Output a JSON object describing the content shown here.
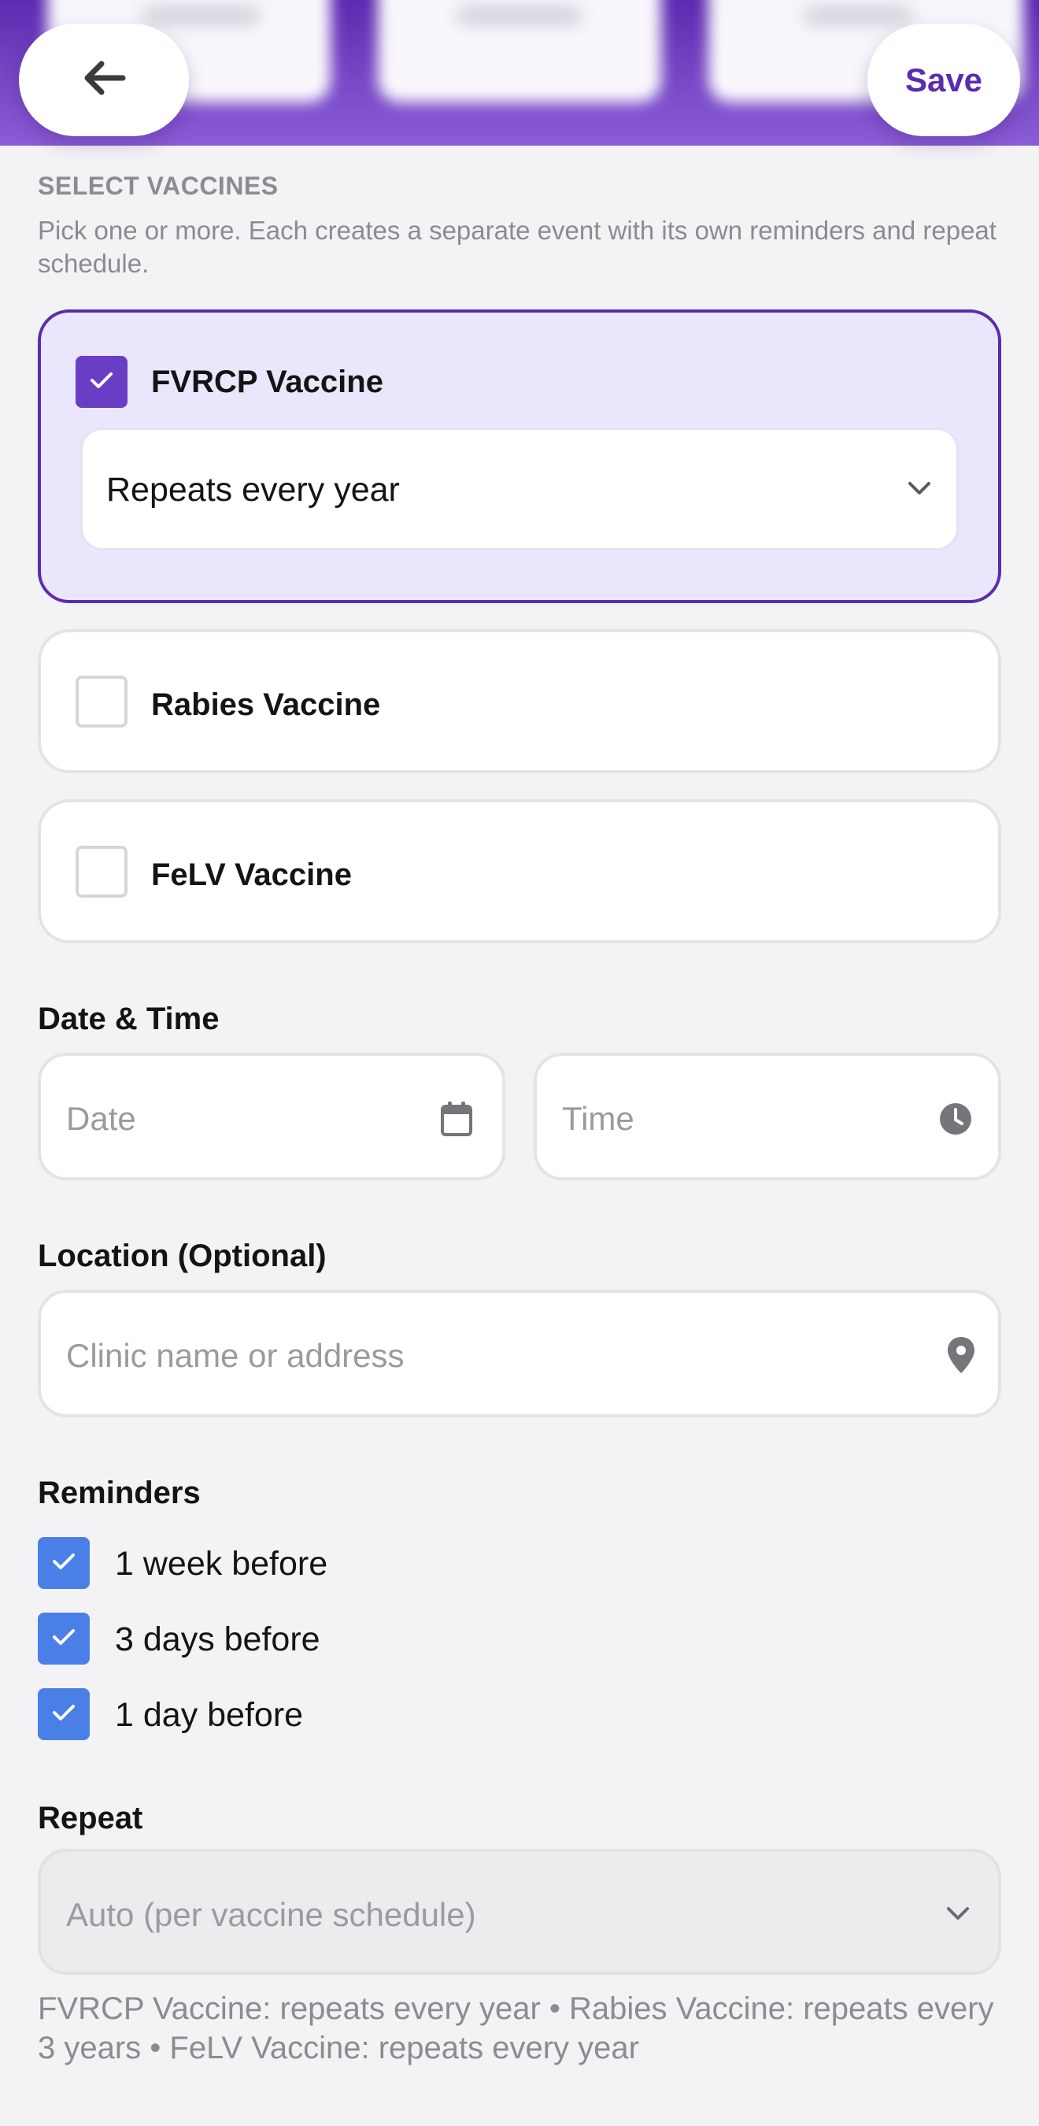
{
  "header": {
    "back_icon": "arrow-left-icon",
    "save_label": "Save",
    "accent": "#5b2bb0"
  },
  "select_vaccines": {
    "heading": "SELECT VACCINES",
    "description": "Pick one or more. Each creates a separate event with its own reminders and repeat schedule.",
    "vaccines": [
      {
        "name": "FVRCP Vaccine",
        "checked": true,
        "repeat": "Repeats every year"
      },
      {
        "name": "Rabies Vaccine",
        "checked": false
      },
      {
        "name": "FeLV Vaccine",
        "checked": false
      }
    ]
  },
  "date_time": {
    "label": "Date & Time",
    "date_placeholder": "Date",
    "time_placeholder": "Time"
  },
  "location": {
    "label": "Location (Optional)",
    "placeholder": "Clinic name or address"
  },
  "reminders": {
    "label": "Reminders",
    "items": [
      {
        "label": "1 week before",
        "checked": true
      },
      {
        "label": "3 days before",
        "checked": true
      },
      {
        "label": "1 day before",
        "checked": true
      }
    ]
  },
  "repeat": {
    "label": "Repeat",
    "value": "Auto (per vaccine schedule)",
    "summary": "FVRCP Vaccine: repeats every year • Rabies Vaccine: repeats every 3 years • FeLV Vaccine: repeats every year"
  }
}
